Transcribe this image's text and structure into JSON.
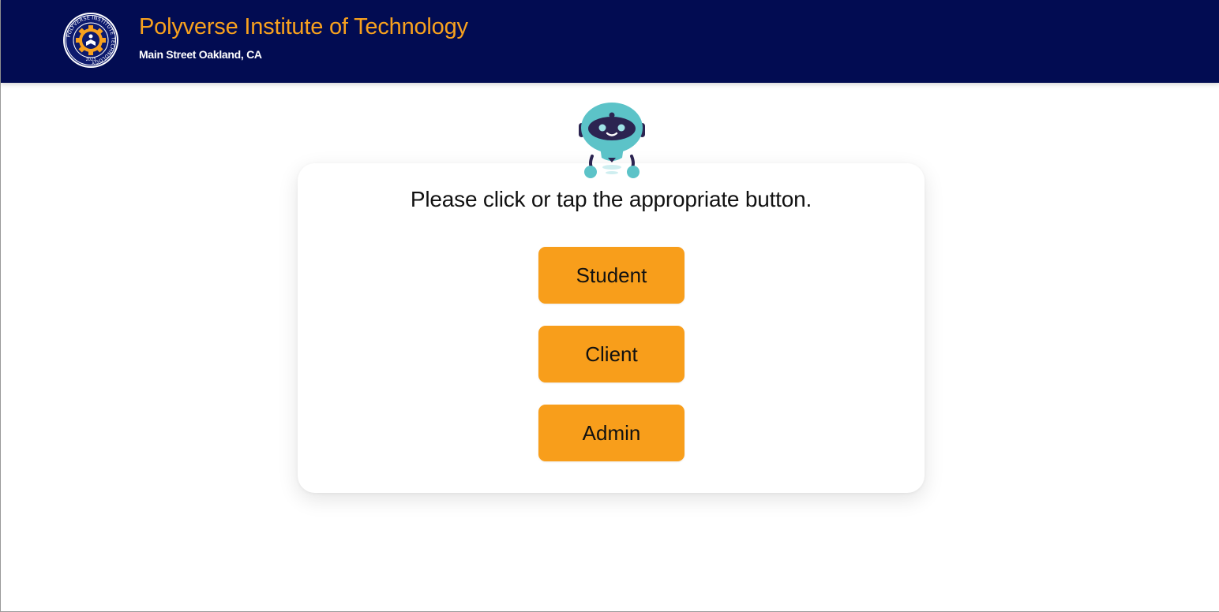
{
  "header": {
    "title": "Polyverse Institute of Technology",
    "subtitle": "Main Street Oakland, CA",
    "logo": {
      "icon": "institute-seal-icon",
      "ring_text": "POLYVERSE INSTITUTE TECHNOLOGY",
      "year": "2023"
    }
  },
  "mascot": {
    "icon": "robot-mascot-icon"
  },
  "card": {
    "prompt": "Please click or tap the appropriate button.",
    "buttons": {
      "student": "Student",
      "client": "Client",
      "admin": "Admin"
    }
  },
  "colors": {
    "header_bg": "#020c52",
    "accent": "#f89e1b",
    "robot_teal": "#5cc3c8",
    "robot_dark": "#2c2451"
  }
}
